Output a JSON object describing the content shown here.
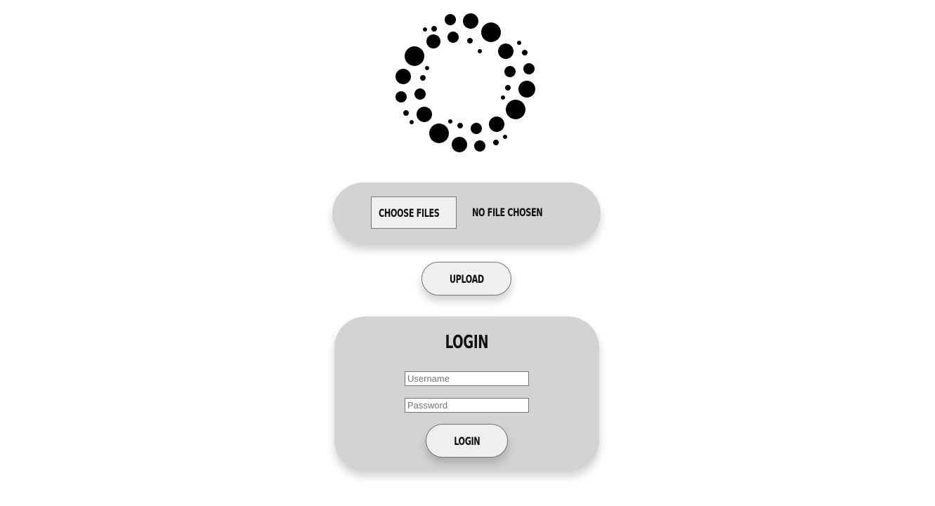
{
  "logo": {
    "icon": "dotted-ring-logo",
    "color": "#000000"
  },
  "upload": {
    "choose_label": "Choose Files",
    "choose_icon": "upload-icon",
    "file_status": "No file chosen",
    "upload_label": "UPLOAD"
  },
  "login": {
    "title": "LOGIN",
    "username_placeholder": "Username",
    "password_placeholder": "Password",
    "button_label": "LOGIN"
  },
  "colors": {
    "panel_bg": "#d3d3d3",
    "button_bg": "#efefef",
    "icon_accent": "#1f3a5a"
  }
}
